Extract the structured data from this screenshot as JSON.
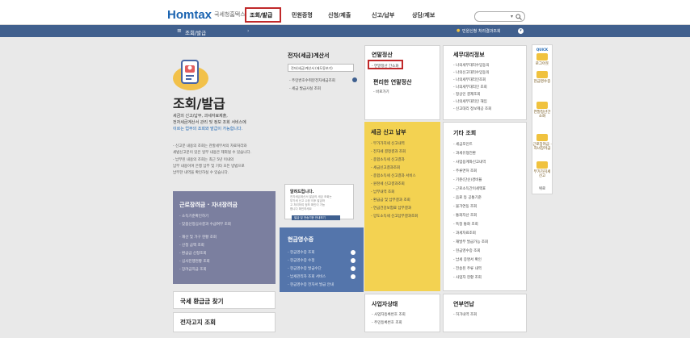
{
  "header": {
    "logo_h": "Hom",
    "logo_tax": "tax",
    "logo_sub": "국세청홈택스",
    "nav": [
      {
        "label": "조회/발급",
        "active": true
      },
      {
        "label": "민원증명"
      },
      {
        "label": "신청/제출"
      },
      {
        "label": "신고/납부"
      },
      {
        "label": "상담/제보"
      }
    ]
  },
  "breadcrumb": {
    "current": "조회/발급",
    "right_link": "민원신청 처리결과조회"
  },
  "hero": {
    "title": "조회/발급",
    "desc1": "세금의 신고/납부, 과세자료제출,",
    "desc2": "전자세금계산서 관리 및 정보 조회 서비스에",
    "desc3": "이르는 업무의 조회와 발급이 가능합니다.",
    "notes": [
      "- 신고분 내용의 조회는 관할세무서의 자료처리와",
      "  세법신고분이 있은 일부 내용은 제외될 수 있습니다.",
      "- 납부된 내용의 조회는 최근 5년 이내의",
      "  납부 내용이며 은행 납부 및 기타 모든 방법으로",
      "  납부한 내역을 확인하실 수 있습니다."
    ]
  },
  "panels": {
    "einvoice": {
      "title": "전자(세금)계산서",
      "select": "전자(세금)계산서 (제도동보기)",
      "items": [
        "- 주민번호수취분전자세금조회",
        "- 세금 발급사실 조회"
      ]
    },
    "yearend": {
      "title": "연말정산",
      "item": "- 연말정산 간소화",
      "subtitle": "편리한 연말정산",
      "sub_item": "- 바로가기"
    },
    "agent": {
      "title": "세무대리정보",
      "items": [
        "- 나의세무대리수임동의",
        "- 나의신고대리수임동의",
        "- 나의세무대리인조회",
        "- 나의세무대리인 조회",
        "- 정상인 결제조회",
        "- 나의세무대리인 해임",
        "- 신고대리 정보제공 조회"
      ]
    },
    "tax_report": {
      "title": "세금 신고 납부",
      "items": [
        "- 부가가치세 신고내역",
        "- 전자세 결정결과 조회",
        "- 종합소득세 신고결과",
        "- 세금신고결과조회",
        "- 종합소득세 신고결과 서비스",
        "- 원천세 신고결과조회",
        "- 납부내역 조회",
        "- 환급금 및 납부결과 조회",
        "- 연금건강보험료 납부결과",
        "- 양도소득세 신고납부결과조회"
      ]
    },
    "other": {
      "title": "기타 조회",
      "items": [
        "- 세금포인트",
        "- 과세유형전환",
        "- 사업용계좌신고내역",
        "- 주류면허 조회",
        "- 기준(단순)경비율",
        "- 근로소득간이세액표",
        "- 음료 등 공통기준",
        "- 물가연동 조회",
        "- 통화자산 조회",
        "- 특정 통화 조회",
        "- 과세자료조회",
        "- 재발부 발급가능 조회",
        "- 현금영수증 조회",
        "- 납세 증명서 확인",
        "- 전송된 주류 내역",
        "- 사업자 현황 조회"
      ]
    },
    "cash_receipt": {
      "title": "현금영수증",
      "items": [
        "- 현금영수증 조회",
        "- 현금영수증 수정",
        "- 현금영수증 발급수단",
        "- 납세관리자 조회 서비스",
        "- 현금영수증 전자서 발급 안내"
      ]
    },
    "business": {
      "title": "사업자상태",
      "items": [
        "- 사업자등록번호 조회",
        "- 주민등록번호 조회"
      ]
    },
    "annuity": {
      "title": "연부연납",
      "items": [
        "- 허가내역 조회"
      ]
    }
  },
  "notice": {
    "title": "알려드립니다.",
    "lines": [
      "전자세금계산서 발급의 세금 조회는",
      "부가세 신고 수정 이후 발급하",
      "고 처리하여 정보 확인이 가능",
      "합니다 확인하세요"
    ],
    "button": "발급 및 전송기한 안내보기"
  },
  "purple_panel": {
    "title": "근로장려금 · 자녀장려금",
    "items": [
      "- 소득기준확인하기",
      "- 맞춤선정심사결과 수급여부 조회",
      "- 재산 및 가구 현황 조회",
      "- 신청 금액 조회",
      "- 환급금 신청조회",
      "- 심사진행현황 조회",
      "- 장려금지급 조회"
    ]
  },
  "bottom_links": {
    "refund": "국세 환급금 찾기",
    "bill": "전자고지 조회"
  },
  "quick_menu": {
    "title": "QUICK",
    "items": [
      "로그아웃",
      "현금영수증",
      "연말정산간소화",
      "근로장려금 · 자녀장려금",
      "부가가치세 신고",
      "위로"
    ]
  }
}
